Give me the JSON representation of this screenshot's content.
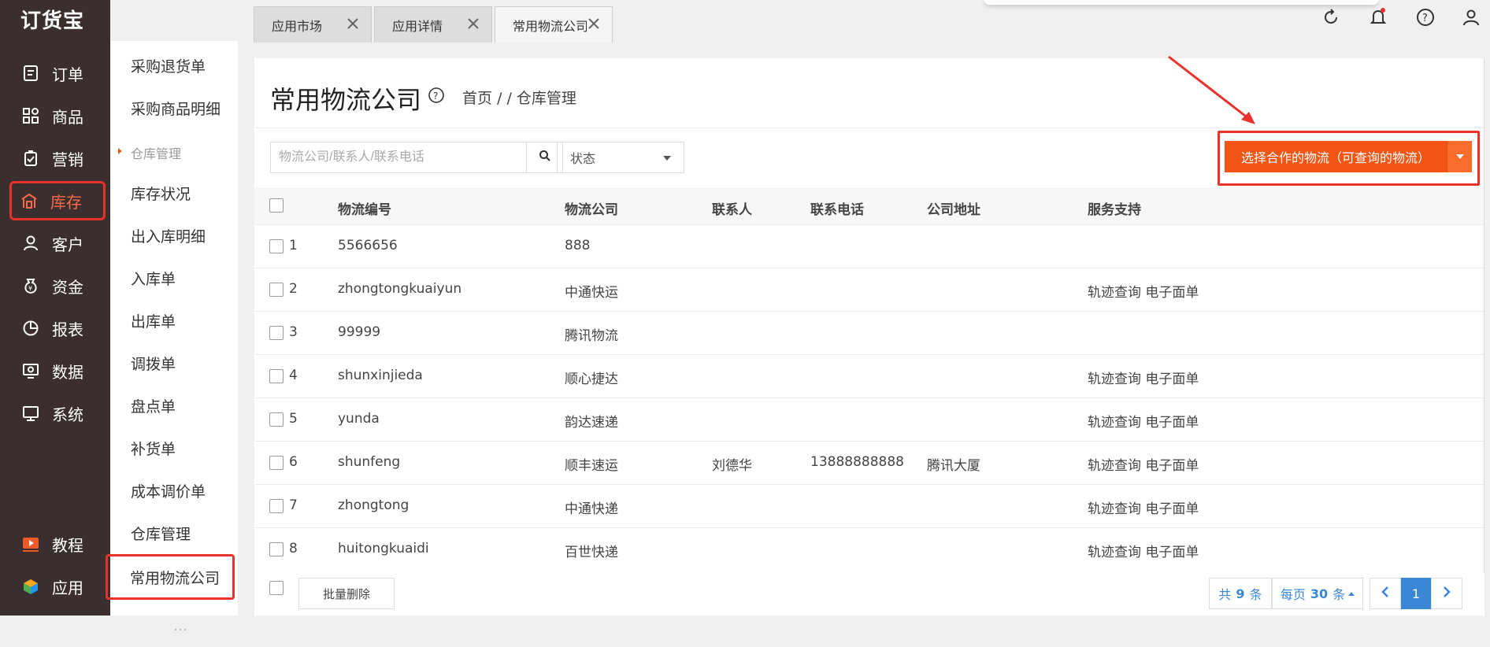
{
  "app": {
    "logo": "订货宝"
  },
  "nav": {
    "items": [
      {
        "label": "订单",
        "icon": "order-icon"
      },
      {
        "label": "商品",
        "icon": "product-grid-icon"
      },
      {
        "label": "营销",
        "icon": "marketing-icon"
      },
      {
        "label": "库存",
        "icon": "warehouse-icon",
        "active": true
      },
      {
        "label": "客户",
        "icon": "user-icon"
      },
      {
        "label": "资金",
        "icon": "money-bag-icon"
      },
      {
        "label": "报表",
        "icon": "pie-chart-icon"
      },
      {
        "label": "数据",
        "icon": "data-screen-icon"
      },
      {
        "label": "系统",
        "icon": "monitor-icon"
      }
    ],
    "bottom": [
      {
        "label": "教程",
        "icon": "video-play-icon"
      },
      {
        "label": "应用",
        "icon": "app-cube-icon"
      }
    ]
  },
  "subnav": {
    "items": [
      "采购退货单",
      "采购商品明细"
    ],
    "section": "仓库管理",
    "section_items": [
      "库存状况",
      "出入库明细",
      "入库单",
      "出库单",
      "调拨单",
      "盘点单",
      "补货单",
      "成本调价单",
      "仓库管理",
      "常用物流公司"
    ],
    "current": "常用物流公司",
    "partial_last": "..."
  },
  "tabs": [
    {
      "label": "应用市场"
    },
    {
      "label": "应用详情"
    },
    {
      "label": "常用物流公司",
      "active": true
    }
  ],
  "topbar": {
    "icons": [
      "refresh-icon",
      "bell-icon",
      "help-icon",
      "user-icon"
    ]
  },
  "page": {
    "title": "常用物流公司",
    "breadcrumb": "首页 / / 仓库管理",
    "search_placeholder": "物流公司/联系人/联系电话",
    "status_label": "状态",
    "cta_label": "选择合作的物流（可查询的物流）"
  },
  "table": {
    "columns": [
      "物流编号",
      "物流公司",
      "联系人",
      "联系电话",
      "公司地址",
      "服务支持"
    ],
    "rows": [
      {
        "idx": "1",
        "code": "5566656",
        "company": "888",
        "contact": "",
        "phone": "",
        "address": "",
        "service": ""
      },
      {
        "idx": "2",
        "code": "zhongtongkuaiyun",
        "company": "中通快运",
        "contact": "",
        "phone": "",
        "address": "",
        "service": "轨迹查询 电子面单"
      },
      {
        "idx": "3",
        "code": "99999",
        "company": "腾讯物流",
        "contact": "",
        "phone": "",
        "address": "",
        "service": ""
      },
      {
        "idx": "4",
        "code": "shunxinjieda",
        "company": "顺心捷达",
        "contact": "",
        "phone": "",
        "address": "",
        "service": "轨迹查询 电子面单"
      },
      {
        "idx": "5",
        "code": "yunda",
        "company": "韵达速递",
        "contact": "",
        "phone": "",
        "address": "",
        "service": "轨迹查询 电子面单"
      },
      {
        "idx": "6",
        "code": "shunfeng",
        "company": "顺丰速运",
        "contact": "刘德华",
        "phone": "13888888888",
        "address": "腾讯大厦",
        "service": "轨迹查询 电子面单"
      },
      {
        "idx": "7",
        "code": "zhongtong",
        "company": "中通快递",
        "contact": "",
        "phone": "",
        "address": "",
        "service": "轨迹查询 电子面单"
      },
      {
        "idx": "8",
        "code": "huitongkuaidi",
        "company": "百世快递",
        "contact": "",
        "phone": "",
        "address": "",
        "service": "轨迹查询 电子面单"
      }
    ]
  },
  "footer": {
    "bulk_delete": "批量删除",
    "total_prefix": "共",
    "total": "9",
    "total_suffix": "条",
    "per_page_prefix": "每页",
    "per_page": "30",
    "per_page_suffix": "条",
    "current_page": "1"
  },
  "colors": {
    "accent": "#f35515",
    "highlight": "#e8322a",
    "nav_bg": "#3a2e2e",
    "link": "#3a87d6"
  }
}
